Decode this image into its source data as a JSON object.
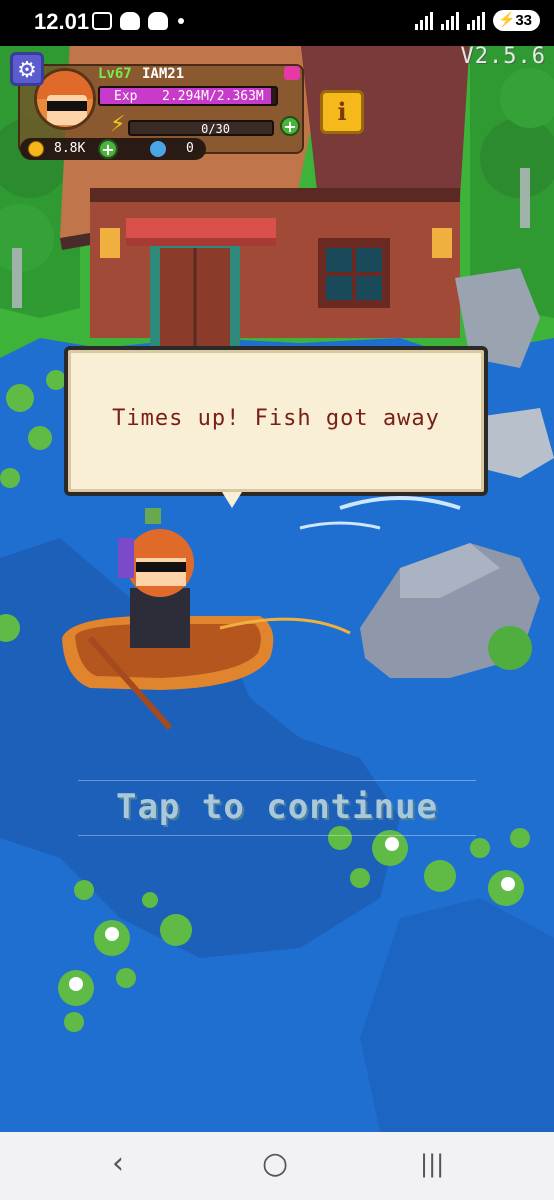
{
  "status_bar": {
    "time": "12.01",
    "battery": "33"
  },
  "hud": {
    "level": "Lv67",
    "player_name": "IAM21",
    "exp_label": "Exp",
    "exp_value": "2.294M/2.363M",
    "exp_fraction": 0.97,
    "energy_value": "0/30",
    "coins": "8.8K",
    "gems": "0",
    "info_label": "i",
    "version": "V2.5.6"
  },
  "dialog": {
    "message": "Times up! Fish got away"
  },
  "prompt": {
    "tap_to_continue": "Tap to continue"
  },
  "nav": {
    "back": "‹",
    "home": "○",
    "recents": "|||"
  },
  "colors": {
    "water": "#1f6fd0",
    "grass": "#3db33a",
    "dialog_text": "#7a1f15",
    "exp_fill": "#c83ac9",
    "info_button": "#f5b91c"
  }
}
